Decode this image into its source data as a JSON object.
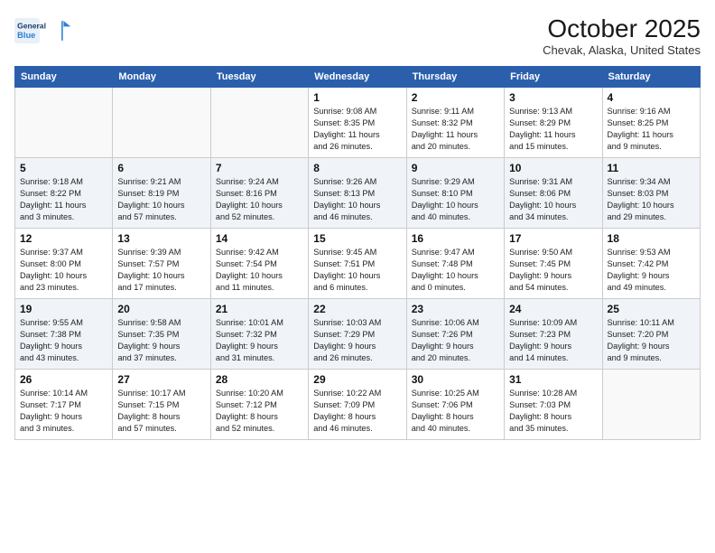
{
  "header": {
    "logo_line1": "General",
    "logo_line2": "Blue",
    "month": "October 2025",
    "location": "Chevak, Alaska, United States"
  },
  "days_of_week": [
    "Sunday",
    "Monday",
    "Tuesday",
    "Wednesday",
    "Thursday",
    "Friday",
    "Saturday"
  ],
  "weeks": [
    [
      {
        "day": "",
        "info": ""
      },
      {
        "day": "",
        "info": ""
      },
      {
        "day": "",
        "info": ""
      },
      {
        "day": "1",
        "info": "Sunrise: 9:08 AM\nSunset: 8:35 PM\nDaylight: 11 hours\nand 26 minutes."
      },
      {
        "day": "2",
        "info": "Sunrise: 9:11 AM\nSunset: 8:32 PM\nDaylight: 11 hours\nand 20 minutes."
      },
      {
        "day": "3",
        "info": "Sunrise: 9:13 AM\nSunset: 8:29 PM\nDaylight: 11 hours\nand 15 minutes."
      },
      {
        "day": "4",
        "info": "Sunrise: 9:16 AM\nSunset: 8:25 PM\nDaylight: 11 hours\nand 9 minutes."
      }
    ],
    [
      {
        "day": "5",
        "info": "Sunrise: 9:18 AM\nSunset: 8:22 PM\nDaylight: 11 hours\nand 3 minutes."
      },
      {
        "day": "6",
        "info": "Sunrise: 9:21 AM\nSunset: 8:19 PM\nDaylight: 10 hours\nand 57 minutes."
      },
      {
        "day": "7",
        "info": "Sunrise: 9:24 AM\nSunset: 8:16 PM\nDaylight: 10 hours\nand 52 minutes."
      },
      {
        "day": "8",
        "info": "Sunrise: 9:26 AM\nSunset: 8:13 PM\nDaylight: 10 hours\nand 46 minutes."
      },
      {
        "day": "9",
        "info": "Sunrise: 9:29 AM\nSunset: 8:10 PM\nDaylight: 10 hours\nand 40 minutes."
      },
      {
        "day": "10",
        "info": "Sunrise: 9:31 AM\nSunset: 8:06 PM\nDaylight: 10 hours\nand 34 minutes."
      },
      {
        "day": "11",
        "info": "Sunrise: 9:34 AM\nSunset: 8:03 PM\nDaylight: 10 hours\nand 29 minutes."
      }
    ],
    [
      {
        "day": "12",
        "info": "Sunrise: 9:37 AM\nSunset: 8:00 PM\nDaylight: 10 hours\nand 23 minutes."
      },
      {
        "day": "13",
        "info": "Sunrise: 9:39 AM\nSunset: 7:57 PM\nDaylight: 10 hours\nand 17 minutes."
      },
      {
        "day": "14",
        "info": "Sunrise: 9:42 AM\nSunset: 7:54 PM\nDaylight: 10 hours\nand 11 minutes."
      },
      {
        "day": "15",
        "info": "Sunrise: 9:45 AM\nSunset: 7:51 PM\nDaylight: 10 hours\nand 6 minutes."
      },
      {
        "day": "16",
        "info": "Sunrise: 9:47 AM\nSunset: 7:48 PM\nDaylight: 10 hours\nand 0 minutes."
      },
      {
        "day": "17",
        "info": "Sunrise: 9:50 AM\nSunset: 7:45 PM\nDaylight: 9 hours\nand 54 minutes."
      },
      {
        "day": "18",
        "info": "Sunrise: 9:53 AM\nSunset: 7:42 PM\nDaylight: 9 hours\nand 49 minutes."
      }
    ],
    [
      {
        "day": "19",
        "info": "Sunrise: 9:55 AM\nSunset: 7:38 PM\nDaylight: 9 hours\nand 43 minutes."
      },
      {
        "day": "20",
        "info": "Sunrise: 9:58 AM\nSunset: 7:35 PM\nDaylight: 9 hours\nand 37 minutes."
      },
      {
        "day": "21",
        "info": "Sunrise: 10:01 AM\nSunset: 7:32 PM\nDaylight: 9 hours\nand 31 minutes."
      },
      {
        "day": "22",
        "info": "Sunrise: 10:03 AM\nSunset: 7:29 PM\nDaylight: 9 hours\nand 26 minutes."
      },
      {
        "day": "23",
        "info": "Sunrise: 10:06 AM\nSunset: 7:26 PM\nDaylight: 9 hours\nand 20 minutes."
      },
      {
        "day": "24",
        "info": "Sunrise: 10:09 AM\nSunset: 7:23 PM\nDaylight: 9 hours\nand 14 minutes."
      },
      {
        "day": "25",
        "info": "Sunrise: 10:11 AM\nSunset: 7:20 PM\nDaylight: 9 hours\nand 9 minutes."
      }
    ],
    [
      {
        "day": "26",
        "info": "Sunrise: 10:14 AM\nSunset: 7:17 PM\nDaylight: 9 hours\nand 3 minutes."
      },
      {
        "day": "27",
        "info": "Sunrise: 10:17 AM\nSunset: 7:15 PM\nDaylight: 8 hours\nand 57 minutes."
      },
      {
        "day": "28",
        "info": "Sunrise: 10:20 AM\nSunset: 7:12 PM\nDaylight: 8 hours\nand 52 minutes."
      },
      {
        "day": "29",
        "info": "Sunrise: 10:22 AM\nSunset: 7:09 PM\nDaylight: 8 hours\nand 46 minutes."
      },
      {
        "day": "30",
        "info": "Sunrise: 10:25 AM\nSunset: 7:06 PM\nDaylight: 8 hours\nand 40 minutes."
      },
      {
        "day": "31",
        "info": "Sunrise: 10:28 AM\nSunset: 7:03 PM\nDaylight: 8 hours\nand 35 minutes."
      },
      {
        "day": "",
        "info": ""
      }
    ]
  ]
}
